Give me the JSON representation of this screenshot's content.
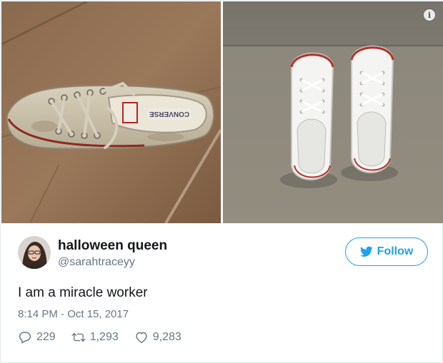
{
  "tweet": {
    "display_name": "halloween queen",
    "handle": "@sarahtraceyy",
    "text": "I am a miracle worker",
    "timestamp": "8:14 PM - Oct 15, 2017",
    "follow_label": "Follow",
    "replies": "229",
    "retweets": "1,293",
    "likes": "9,283"
  },
  "media": {
    "left_photo": "dirty-white-sneaker-on-tile",
    "right_photo": "clean-white-sneakers-on-concrete",
    "shoe_label_text": "CONVERSE"
  },
  "icons": {
    "info": "info-icon",
    "bird": "twitter-bird-icon",
    "reply": "reply-icon",
    "retweet": "retweet-icon",
    "like": "heart-icon"
  },
  "colors": {
    "accent": "#1da1f2",
    "secondary_text": "#657786",
    "primary_text": "#14171a"
  }
}
